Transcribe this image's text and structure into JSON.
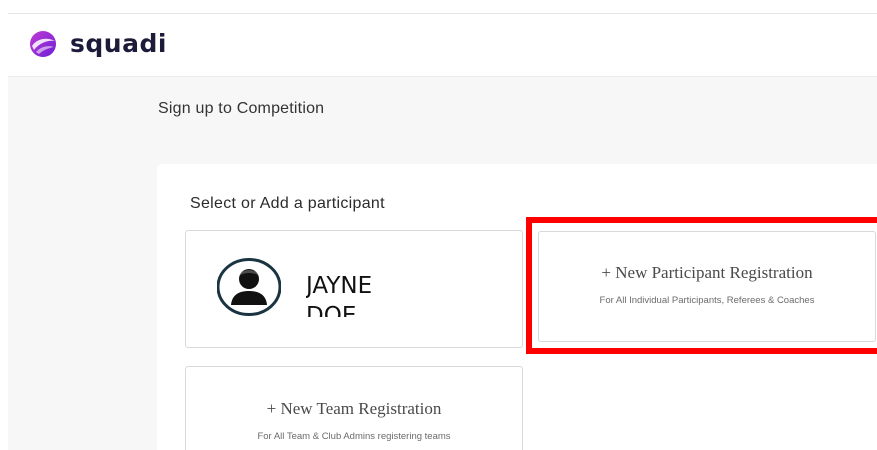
{
  "brand": {
    "name": "squadi",
    "logo_icon": "squadi-logo-icon",
    "colors": {
      "primary": "#6b1fd6",
      "secondary": "#c23bd4",
      "text": "#1d1b3a"
    }
  },
  "page": {
    "title": "Sign up to Competition"
  },
  "section": {
    "title": "Select or Add a participant"
  },
  "participants": [
    {
      "name": "JAYNE DOE",
      "icon": "user-avatar-icon"
    }
  ],
  "actions": {
    "new_participant": {
      "title": "+ New Participant Registration",
      "subtitle": "For All Individual Participants, Referees & Coaches"
    },
    "new_team": {
      "title": "+ New Team Registration",
      "subtitle": "For All Team & Club Admins registering teams"
    }
  },
  "highlight": {
    "target": "new_participant",
    "color": "#ff0000"
  }
}
